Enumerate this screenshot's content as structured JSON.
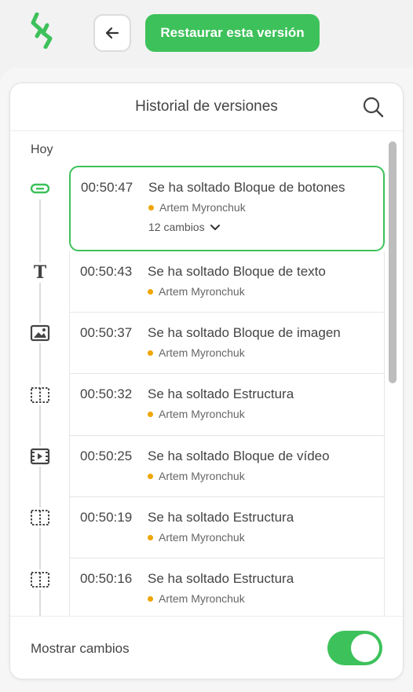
{
  "toolbar": {
    "logo": "stripo-logo-icon",
    "back_icon": "arrow-left-icon",
    "restore_label": "Restaurar esta versión",
    "accent_color": "#3dc15a"
  },
  "panel": {
    "title": "Historial de versiones",
    "search_icon": "search-icon",
    "day_label": "Hoy",
    "entries": [
      {
        "time": "00:50:47",
        "title": "Se ha soltado Bloque de botones",
        "author": "Artem Myronchuk",
        "changes": "12 cambios",
        "icon": "button-block-icon",
        "selected": true
      },
      {
        "time": "00:50:43",
        "title": "Se ha soltado Bloque de texto",
        "author": "Artem Myronchuk",
        "icon": "text-block-icon"
      },
      {
        "time": "00:50:37",
        "title": "Se ha soltado Bloque de imagen",
        "author": "Artem Myronchuk",
        "icon": "image-block-icon"
      },
      {
        "time": "00:50:32",
        "title": "Se ha soltado Estructura",
        "author": "Artem Myronchuk",
        "icon": "structure-icon"
      },
      {
        "time": "00:50:25",
        "title": "Se ha soltado Bloque de vídeo",
        "author": "Artem Myronchuk",
        "icon": "video-block-icon"
      },
      {
        "time": "00:50:19",
        "title": "Se ha soltado Estructura",
        "author": "Artem Myronchuk",
        "icon": "structure-icon"
      },
      {
        "time": "00:50:16",
        "title": "Se ha soltado Estructura",
        "author": "Artem Myronchuk",
        "icon": "structure-icon"
      }
    ],
    "author_dot_color": "#f0a500"
  },
  "footer": {
    "show_changes_label": "Mostrar cambios",
    "toggle_on": true
  }
}
